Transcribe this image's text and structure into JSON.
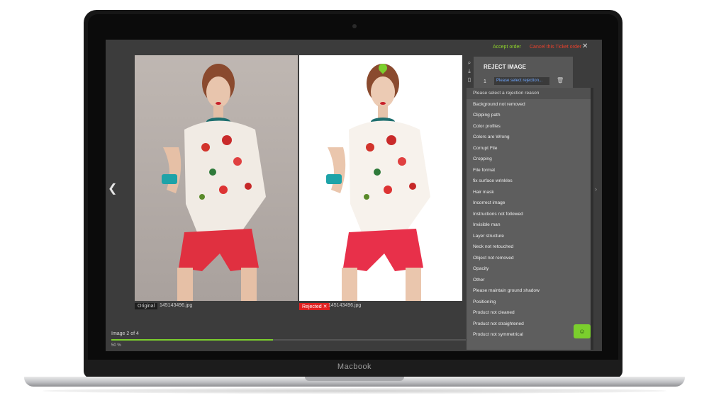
{
  "device": {
    "brand": "Macbook"
  },
  "toolbar": {
    "accept_label": "Accept order",
    "cancel_label": "Cancel this Ticket order",
    "close_icon": "close-icon"
  },
  "viewer": {
    "prev_icon": "chevron-left-icon",
    "next_icon": "chevron-right-icon",
    "original_label": "Original",
    "original_file": "145143496.jpg",
    "rejected_label": "Rejected ✕",
    "rejected_file": "145143496.jpg"
  },
  "reject": {
    "title": "REJECT IMAGE",
    "row_number": "1",
    "select_value": "Please select rejection...",
    "reasons": [
      "Please select a rejection reason",
      "Background not removed",
      "Clipping path",
      "Color profiles",
      "Colors are Wrong",
      "Corrupt File",
      "Cropping",
      "File format",
      "fix surface wrinkles",
      "Hair mask",
      "Incorrect image",
      "Instructions not followed",
      "Invisible man",
      "Layer structure",
      "Neck not retouched",
      "Object not removed",
      "Opacity",
      "Other",
      "Please maintain ground shadow",
      "Positioning",
      "Product not cleaned",
      "Product not straightened",
      "Product not symmetrical"
    ]
  },
  "status": {
    "counter": "Image 2 of 4",
    "progress_text": "50 %",
    "progress_fraction": 0.5
  },
  "colors": {
    "accent": "#7bcf2d",
    "danger": "#e02020"
  }
}
